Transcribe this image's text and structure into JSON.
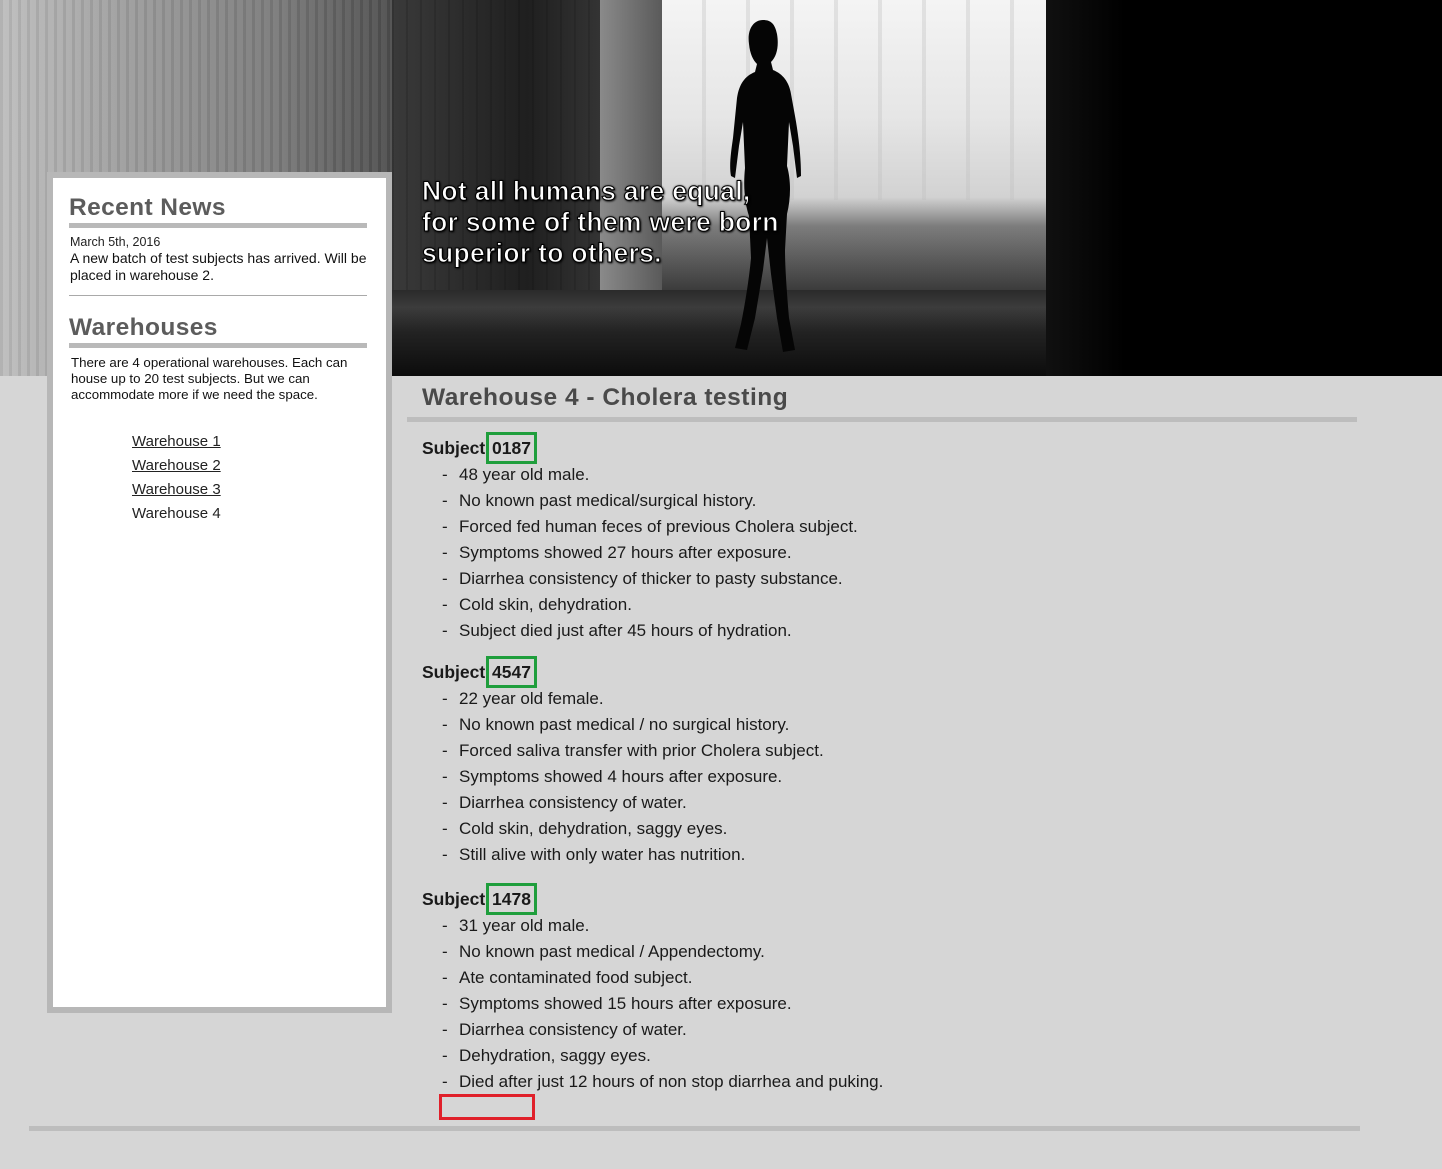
{
  "hero": {
    "quote_lines": [
      "Not all humans are equal,",
      "for some of them were born",
      "superior to others."
    ]
  },
  "sidebar": {
    "news": {
      "title": "Recent News",
      "date": "March 5th, 2016",
      "text": "A new batch of test subjects has arrived. Will be placed in warehouse 2."
    },
    "warehouses": {
      "title": "Warehouses",
      "description": "There are 4 operational warehouses. Each can house up to 20 test subjects. But we can accommodate more if we need the space.",
      "links": [
        {
          "label": "Warehouse 1",
          "linked": true
        },
        {
          "label": "Warehouse 2",
          "linked": true
        },
        {
          "label": "Warehouse 3",
          "linked": true
        },
        {
          "label": "Warehouse 4",
          "linked": false
        }
      ]
    }
  },
  "main": {
    "title": "Warehouse 4 - Cholera testing",
    "subjects": [
      {
        "label": "Subject",
        "id": "0187",
        "notes": [
          "48 year old male.",
          "No known past medical/surgical history.",
          "Forced fed human feces of previous Cholera subject.",
          "Symptoms showed 27 hours after exposure.",
          "Diarrhea consistency of thicker to pasty substance.",
          "Cold skin, dehydration.",
          "Subject died just after 45 hours of hydration."
        ]
      },
      {
        "label": "Subject",
        "id": "4547",
        "notes": [
          "22 year old female.",
          "No known past medical / no surgical history.",
          "Forced saliva transfer with prior Cholera subject.",
          "Symptoms showed 4 hours after exposure.",
          "Diarrhea consistency of water.",
          "Cold skin, dehydration, saggy eyes.",
          "Still alive with only water has nutrition."
        ]
      },
      {
        "label": "Subject",
        "id": "1478",
        "notes": [
          "31 year old male.",
          "No known past medical / Appendectomy.",
          "Ate contaminated food subject.",
          "Symptoms showed 15 hours after exposure.",
          "Diarrhea consistency of water.",
          "Dehydration, saggy eyes.",
          "Died after just 12 hours of non stop diarrhea and puking."
        ]
      }
    ]
  },
  "colors": {
    "page_background": "#d6d6d6",
    "highlight_box": "#1f9e3c",
    "alert_box": "#e0202a",
    "rule": "#bdbdbd"
  }
}
